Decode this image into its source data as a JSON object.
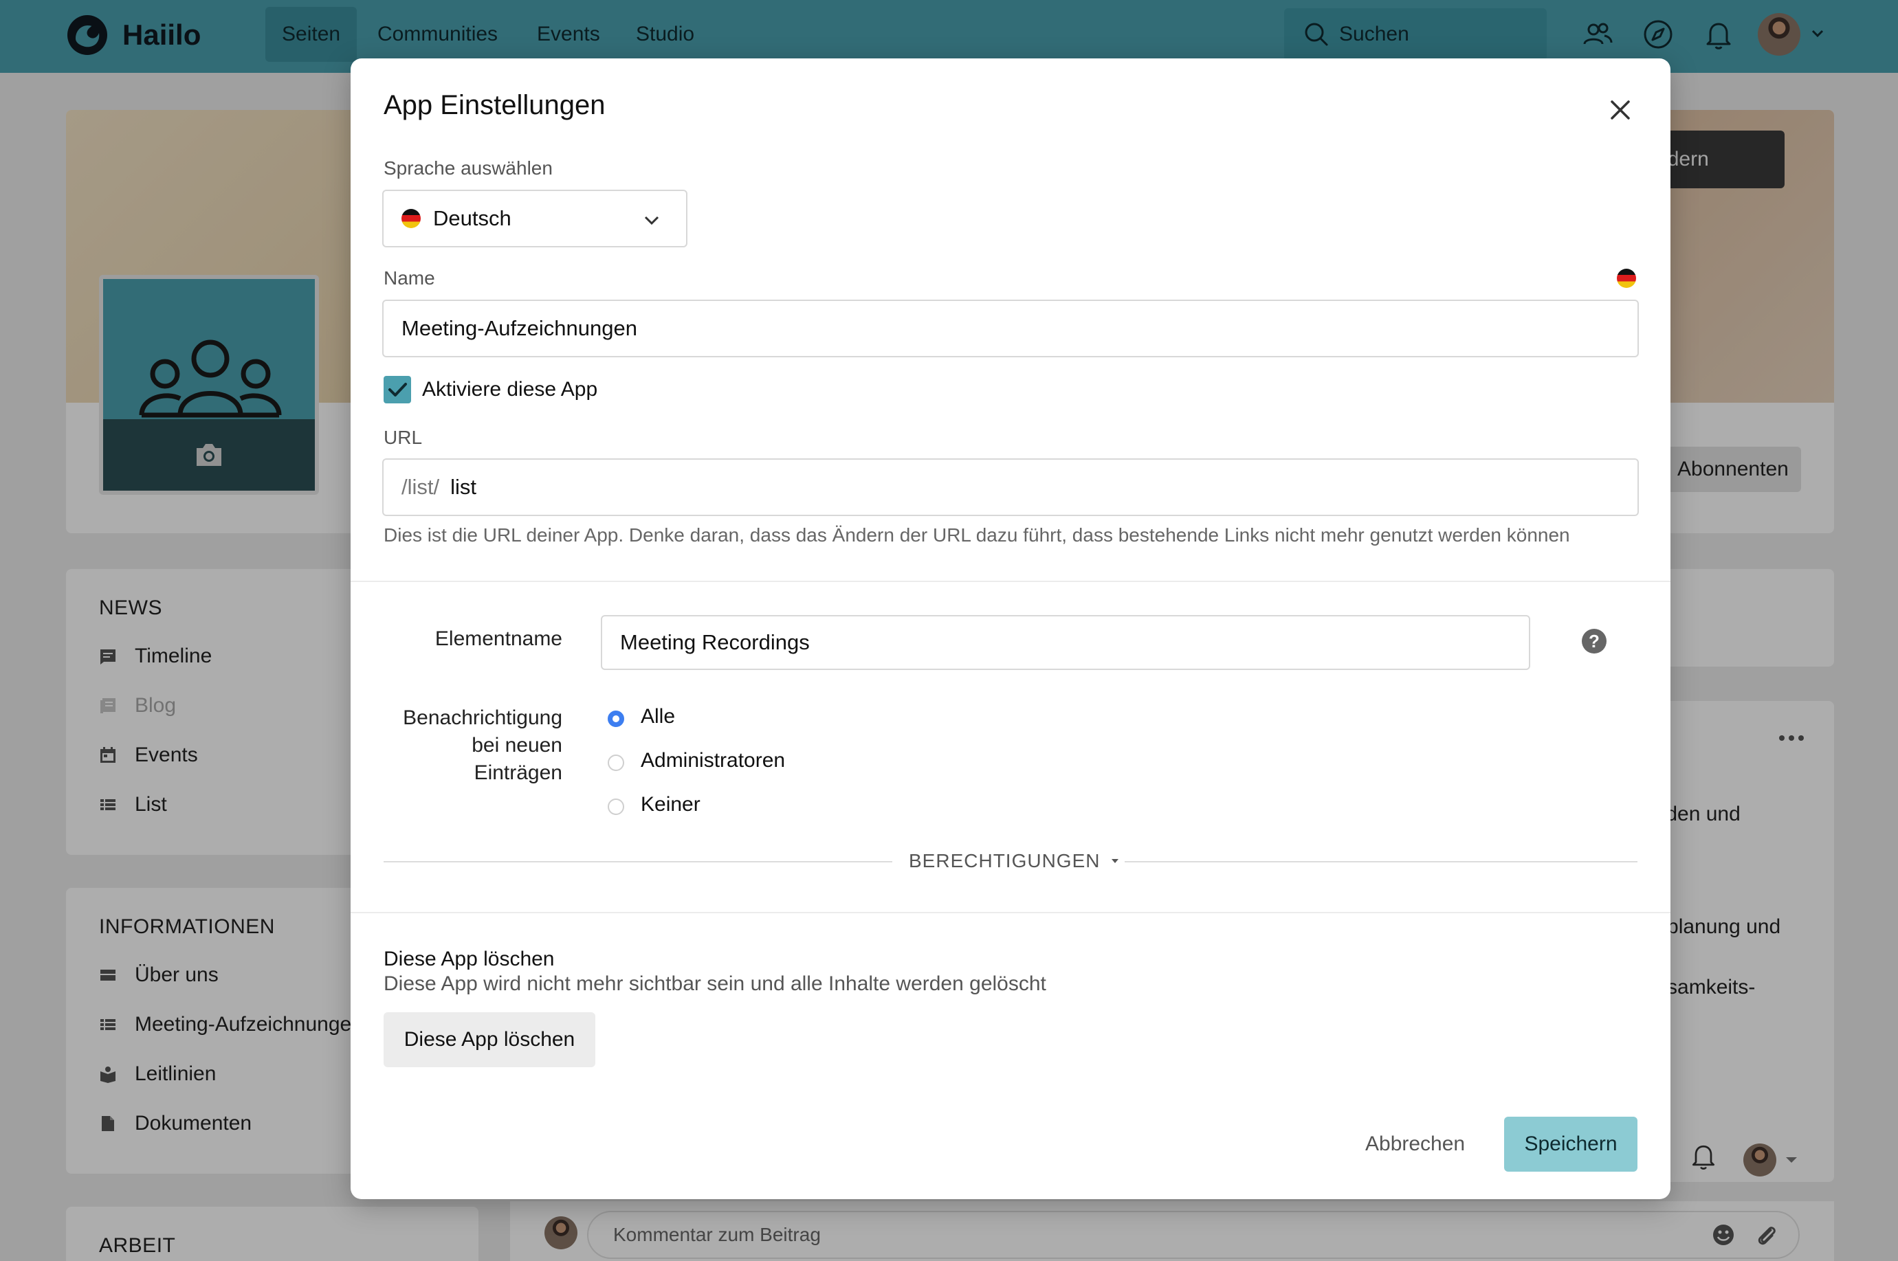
{
  "topnav": {
    "brand": "Haiilo",
    "items": [
      {
        "label": "Seiten",
        "active": true
      },
      {
        "label": "Communities",
        "active": false
      },
      {
        "label": "Events",
        "active": false
      },
      {
        "label": "Studio",
        "active": false
      }
    ],
    "search_label": "Suchen",
    "icons": [
      "people-icon",
      "compass-icon",
      "bell-icon"
    ]
  },
  "page": {
    "cover_button": "ild ändern",
    "subscribers_button": "Abonnenten",
    "news": {
      "title": "NEWS",
      "items": [
        {
          "label": "Timeline",
          "icon": "timeline-icon",
          "muted": false
        },
        {
          "label": "Blog",
          "icon": "blog-icon",
          "muted": true
        },
        {
          "label": "Events",
          "icon": "calendar-icon",
          "muted": false
        },
        {
          "label": "List",
          "icon": "list-icon",
          "muted": false
        }
      ]
    },
    "info": {
      "title": "INFORMATIONEN",
      "items": [
        {
          "label": "Über uns",
          "icon": "content-icon"
        },
        {
          "label": "Meeting-Aufzeichnunge",
          "icon": "list-icon"
        },
        {
          "label": "Leitlinien",
          "icon": "book-icon"
        },
        {
          "label": "Dokumenten",
          "icon": "file-icon"
        }
      ]
    },
    "work_title": "ARBEIT",
    "right_snippets": [
      "inden und",
      "etplanung und",
      "ntsamkeits-"
    ],
    "comment_placeholder": "Kommentar zum Beitrag"
  },
  "modal": {
    "title": "App Einstellungen",
    "language_label": "Sprache auswählen",
    "language_value": "Deutsch",
    "name_label": "Name",
    "name_value": "Meeting-Aufzeichnungen",
    "activate_label": "Aktiviere diese App",
    "activate_checked": true,
    "url_label": "URL",
    "url_prefix": "/list/",
    "url_value": "list",
    "url_help": "Dies ist die URL deiner App. Denke daran, dass das Ändern der URL dazu führt, dass bestehende Links nicht mehr genutzt werden können",
    "element_name_label": "Elementname",
    "element_name_value": "Meeting Recordings",
    "notification_label_lines": [
      "Benachrichtigung",
      "bei neuen",
      "Einträgen"
    ],
    "notification_options": [
      {
        "label": "Alle",
        "selected": true
      },
      {
        "label": "Administratoren",
        "selected": false
      },
      {
        "label": "Keiner",
        "selected": false
      }
    ],
    "permissions_label": "BERECHTIGUNGEN",
    "delete_title": "Diese App löschen",
    "delete_subtitle": "Diese App wird nicht mehr sichtbar sein und alle Inhalte werden gelöscht",
    "delete_button": "Diese App löschen",
    "cancel_button": "Abbrechen",
    "save_button": "Speichern"
  },
  "colors": {
    "brand": "#4b9fae",
    "save": "#8ccbd3",
    "radio": "#3d7ef0"
  }
}
